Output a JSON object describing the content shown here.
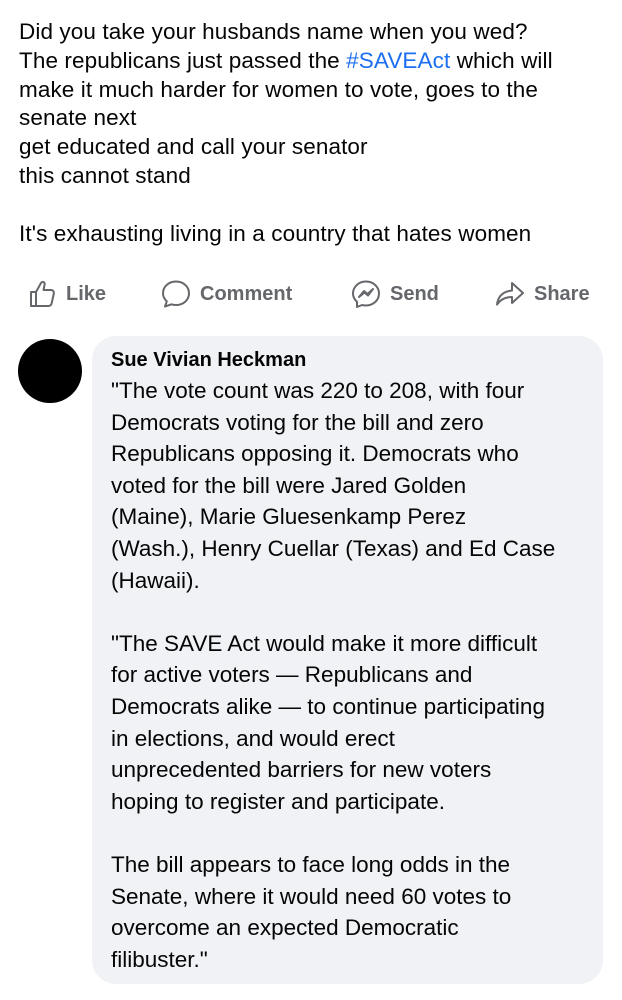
{
  "post": {
    "lines": [
      "Did you take your husbands name when you wed?",
      "The republicans just passed the ",
      "#SAVEAct",
      " which will",
      "make it much harder for women to vote, goes to the",
      "senate next",
      "get educated and call your senator",
      "this cannot stand",
      "It's exhausting living in a country that hates women"
    ]
  },
  "actions": {
    "like": {
      "label": "Like",
      "icon": "thumbs-up-icon"
    },
    "comment": {
      "label": "Comment",
      "icon": "speech-bubble-icon"
    },
    "send": {
      "label": "Send",
      "icon": "messenger-icon"
    },
    "share": {
      "label": "Share",
      "icon": "share-arrow-icon"
    }
  },
  "comment": {
    "author": "Sue Vivian Heckman",
    "lines": [
      "\"The vote count was 220 to 208, with four",
      "Democrats voting for the bill and zero",
      "Republicans opposing it. Democrats who",
      "voted for the bill were Jared Golden",
      "(Maine), Marie Gluesenkamp Perez",
      "(Wash.), Henry Cuellar (Texas) and Ed Case",
      "(Hawaii).",
      "\"The SAVE Act would make it more difficult",
      "for active voters — Republicans and",
      "Democrats alike — to continue participating",
      "in elections, and would erect",
      "unprecedented barriers for new voters",
      "hoping to register and participate.",
      "The bill appears to face long odds in the",
      "Senate, where it would need 60 votes to",
      "overcome an expected Democratic",
      "filibuster.\""
    ]
  },
  "colors": {
    "hashtag": "#1b6ff0",
    "action_gray": "#65676b",
    "bubble_bg": "#f0f2f5",
    "text": "#050505"
  }
}
